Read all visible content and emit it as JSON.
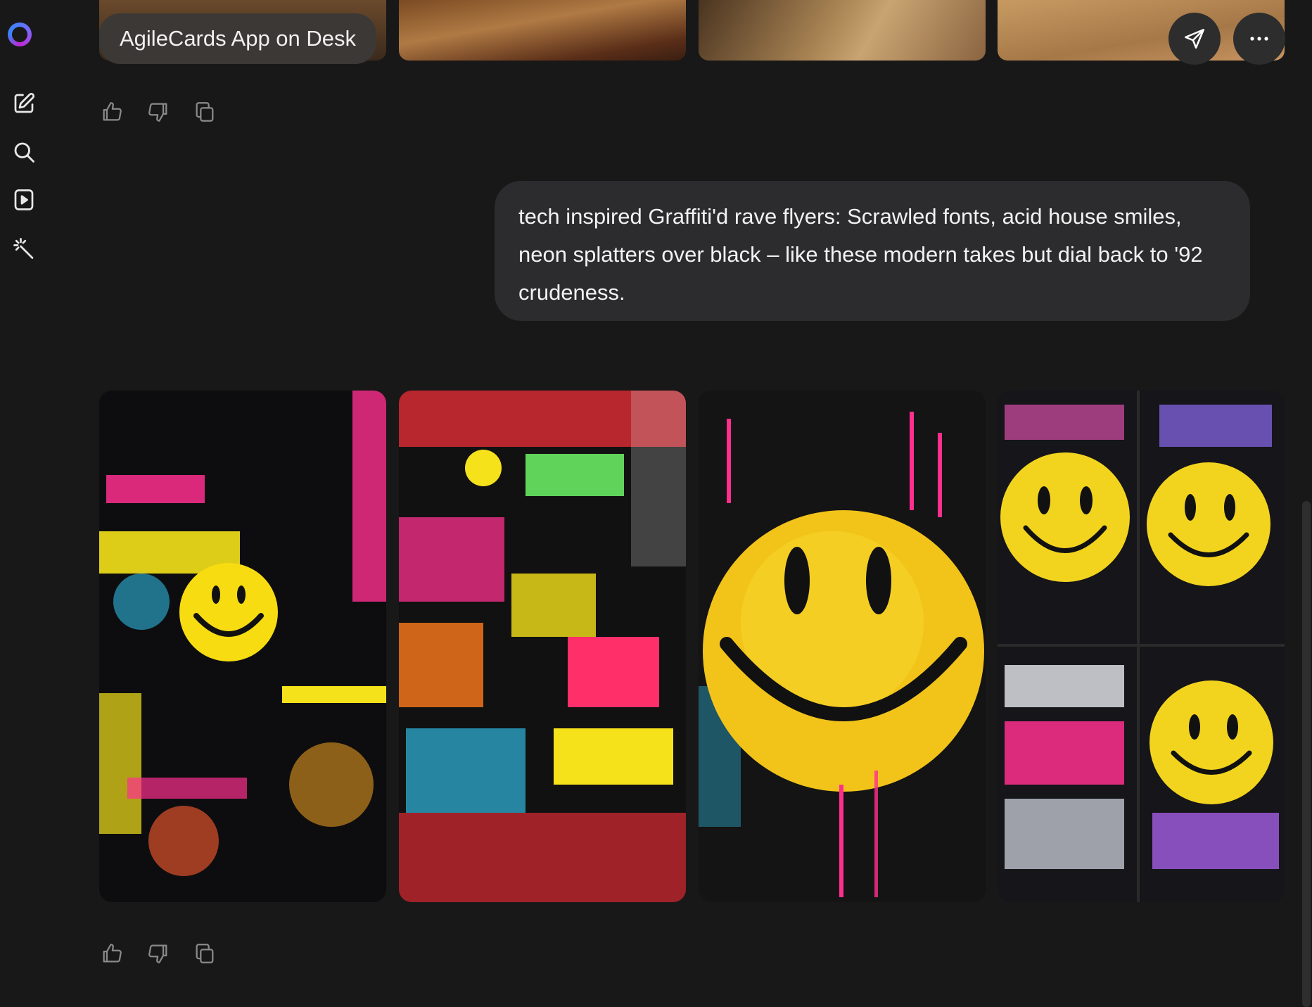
{
  "sidebar": {
    "logo_icon": "assistant-logo-ring",
    "items": [
      {
        "icon": "new-chat-icon"
      },
      {
        "icon": "search-icon"
      },
      {
        "icon": "video-icon"
      },
      {
        "icon": "magic-wand-icon"
      }
    ]
  },
  "top_message": {
    "title": "AgileCards App on Desk",
    "share_icon": "send-icon",
    "more_icon": "more-dots-icon"
  },
  "user_prompt": {
    "text": "tech inspired Graffiti'd rave flyers: Scrawled fonts, acid house smiles, neon splatters over black – like these modern takes but dial back to '92 crudeness."
  },
  "feedback_icons": [
    "thumbs-up-icon",
    "thumbs-down-icon",
    "copy-icon"
  ],
  "colors": {
    "background": "#181818",
    "bubble": "#2c2c2e",
    "pill": "#3b3835",
    "neon_pink": "#ff2f8e",
    "neon_yellow": "#f5e21a",
    "neon_cyan": "#2fb8e0"
  }
}
